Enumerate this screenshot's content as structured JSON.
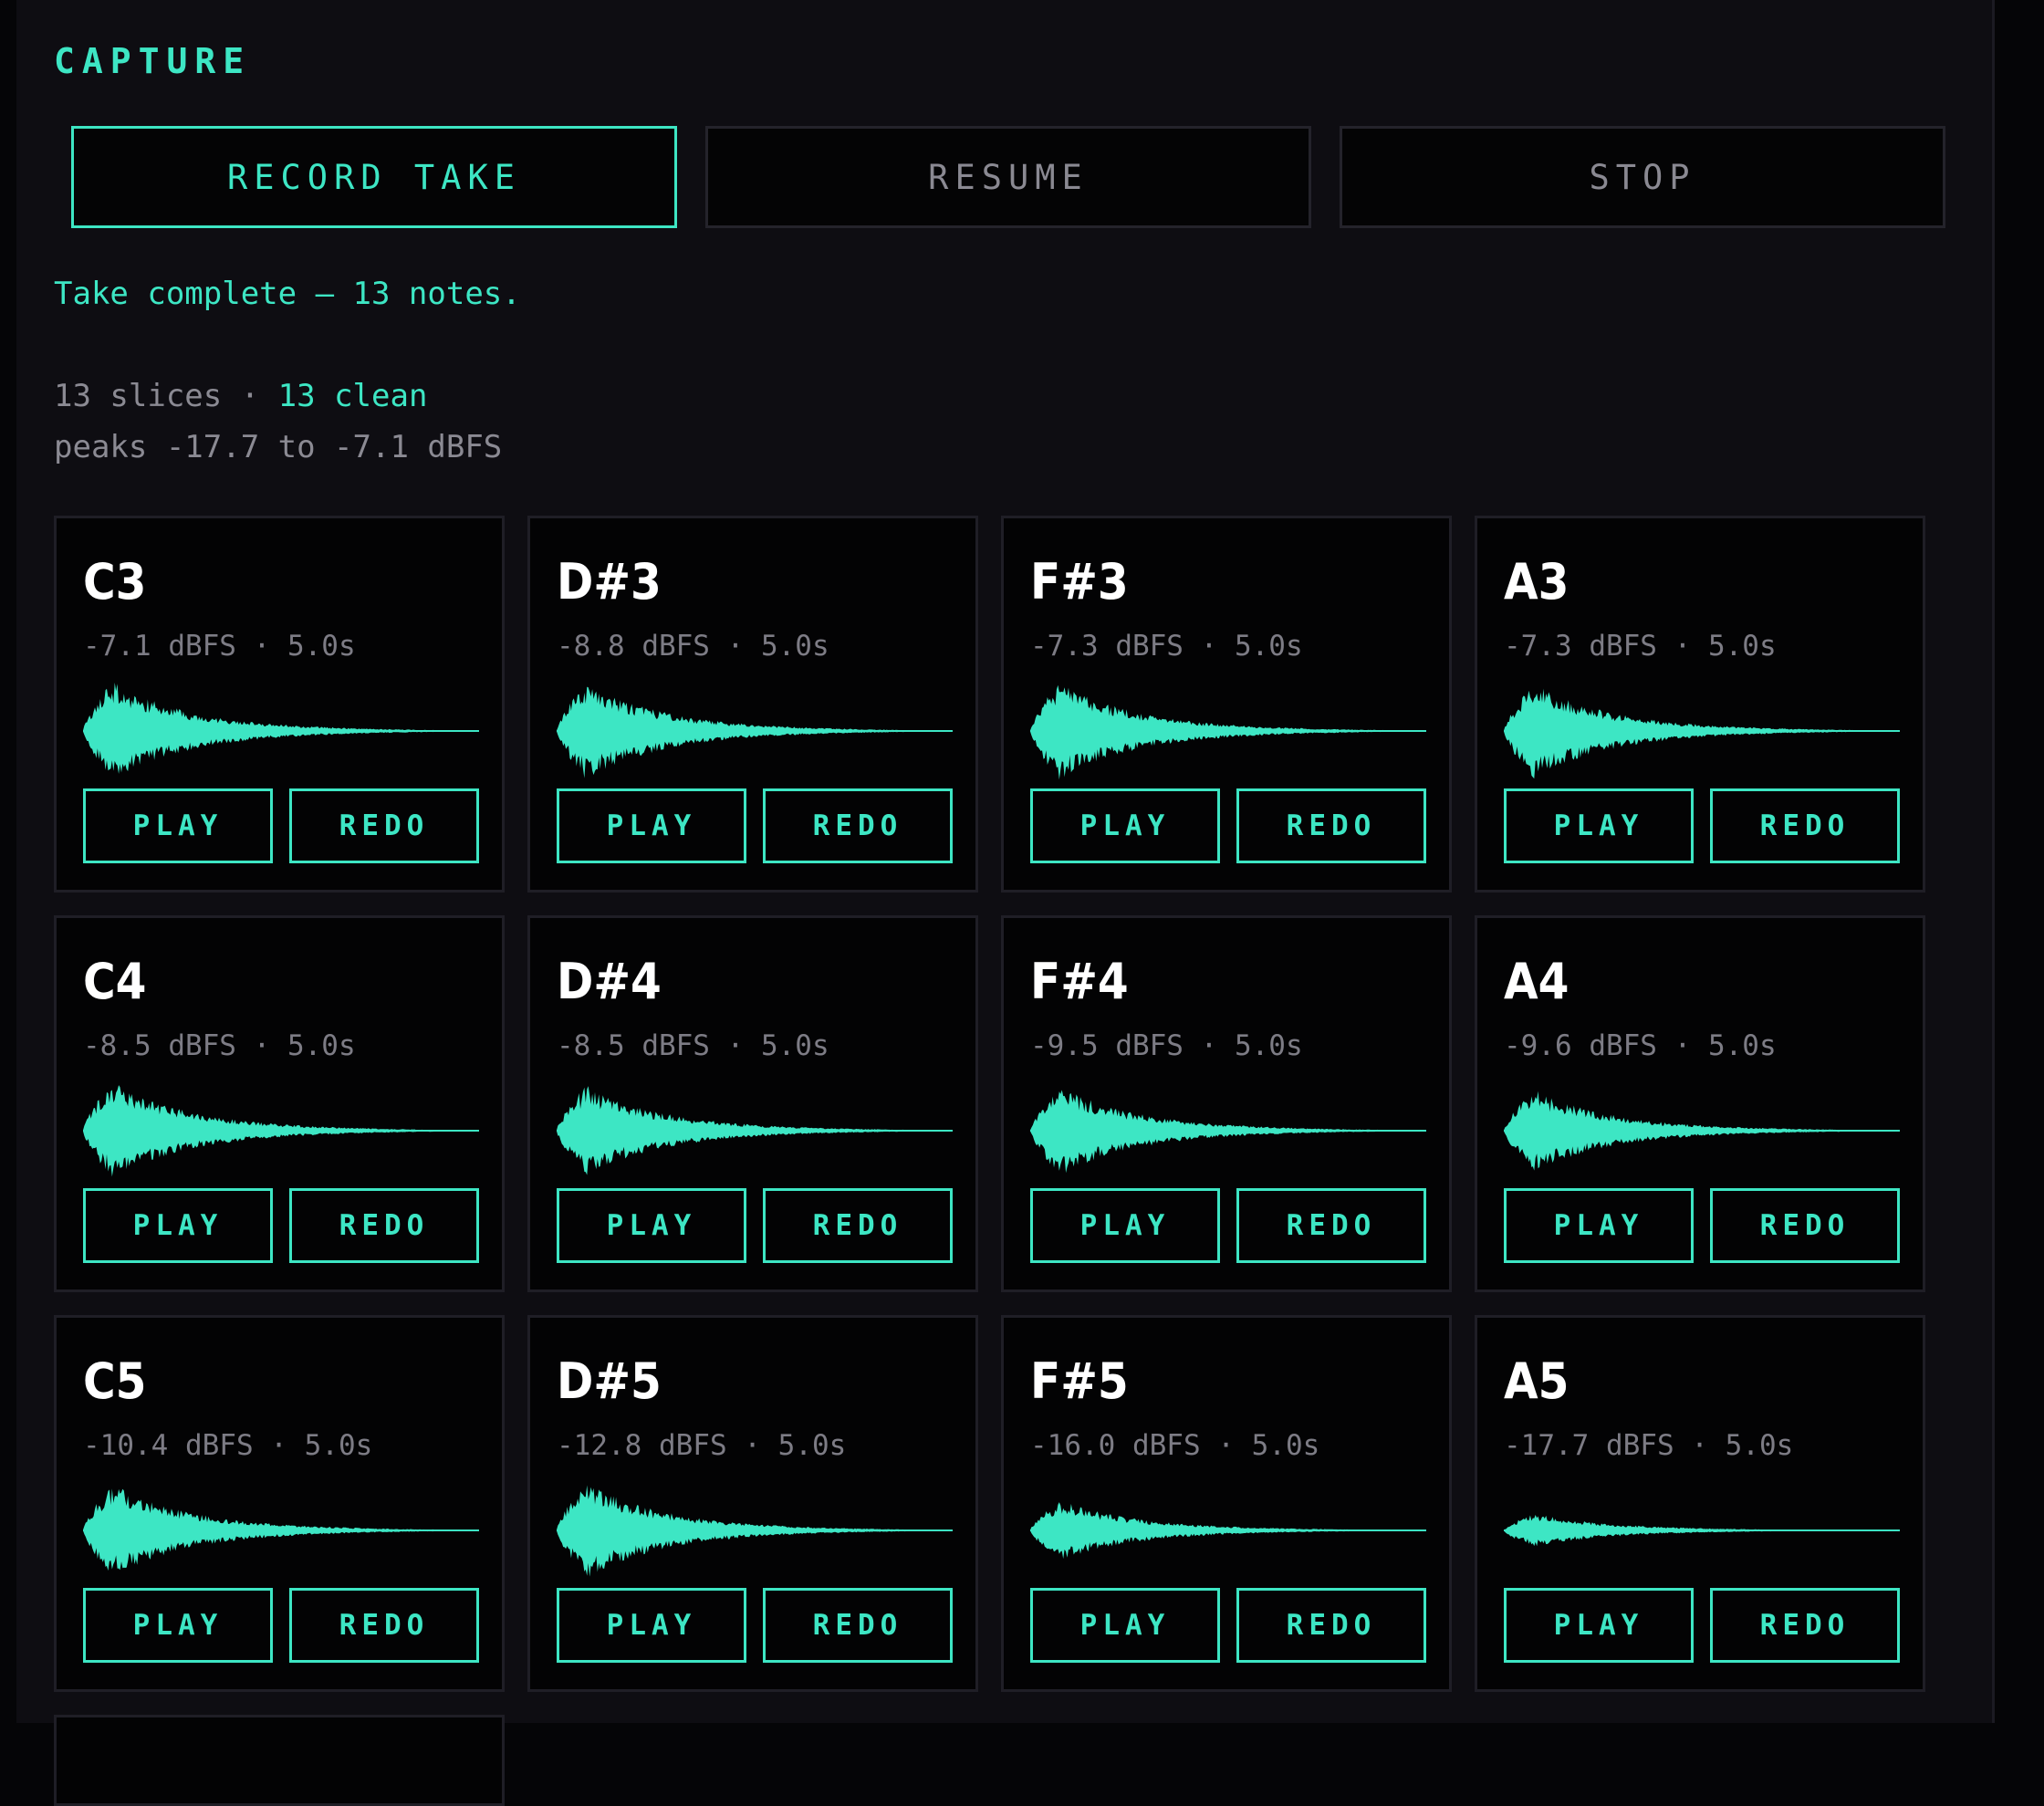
{
  "capture": {
    "title": "CAPTURE",
    "buttons": {
      "record": "RECORD TAKE",
      "resume": "RESUME",
      "stop": "STOP"
    },
    "status": "Take complete — 13 notes.",
    "summary": {
      "slices": "13 slices",
      "separator": " · ",
      "clean": "13 clean",
      "peaks": "peaks -17.7 to -7.1 dBFS"
    }
  },
  "colors": {
    "accent": "#3de6c4",
    "background": "#0e0d12",
    "card": "#030304"
  },
  "card_labels": {
    "play": "PLAY",
    "redo": "REDO"
  },
  "samples": [
    {
      "note": "C3",
      "meta": "-7.1 dBFS · 5.0s",
      "peak": 0.79
    },
    {
      "note": "D#3",
      "meta": "-8.8 dBFS · 5.0s",
      "peak": 0.78
    },
    {
      "note": "F#3",
      "meta": "-7.3 dBFS · 5.0s",
      "peak": 0.78
    },
    {
      "note": "A3",
      "meta": "-7.3 dBFS · 5.0s",
      "peak": 0.76
    },
    {
      "note": "C4",
      "meta": "-8.5 dBFS · 5.0s",
      "peak": 0.78
    },
    {
      "note": "D#4",
      "meta": "-8.5 dBFS · 5.0s",
      "peak": 0.72
    },
    {
      "note": "F#4",
      "meta": "-9.5 dBFS · 5.0s",
      "peak": 0.72
    },
    {
      "note": "A4",
      "meta": "-9.6 dBFS · 5.0s",
      "peak": 0.66
    },
    {
      "note": "C5",
      "meta": "-10.4 dBFS · 5.0s",
      "peak": 0.74
    },
    {
      "note": "D#5",
      "meta": "-12.8 dBFS · 5.0s",
      "peak": 0.77
    },
    {
      "note": "F#5",
      "meta": "-16.0 dBFS · 5.0s",
      "peak": 0.48
    },
    {
      "note": "A5",
      "meta": "-17.7 dBFS · 5.0s",
      "peak": 0.27
    }
  ]
}
